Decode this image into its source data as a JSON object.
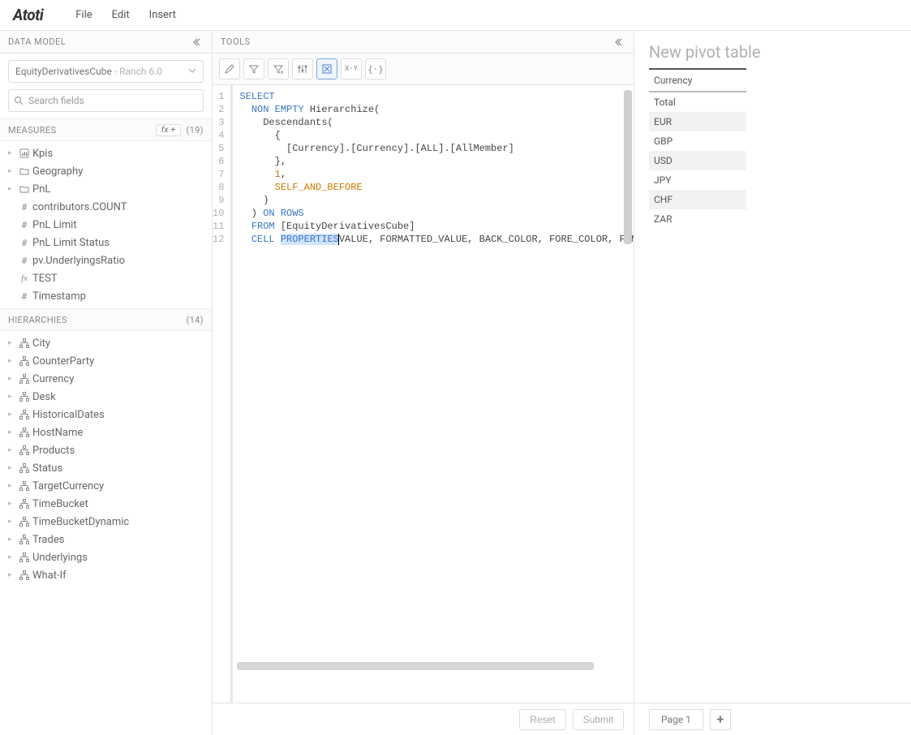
{
  "topbar": {
    "logo": "Atoti",
    "menu": [
      "File",
      "Edit",
      "Insert"
    ]
  },
  "left": {
    "header": "DATA MODEL",
    "cube_name": "EquityDerivativesCube",
    "cube_version": " - Ranch 6.0",
    "search_placeholder": "Search fields",
    "measures": {
      "title": "MEASURES",
      "fx_label": "fx +",
      "count": "(19)",
      "items": [
        {
          "icon": "kpi",
          "label": "Kpis",
          "caret": true
        },
        {
          "icon": "folder",
          "label": "Geography",
          "caret": true
        },
        {
          "icon": "folder",
          "label": "PnL",
          "caret": true
        },
        {
          "icon": "hash",
          "label": "contributors.COUNT",
          "caret": false
        },
        {
          "icon": "hash",
          "label": "PnL Limit",
          "caret": false
        },
        {
          "icon": "hash",
          "label": "PnL Limit Status",
          "caret": false
        },
        {
          "icon": "hash",
          "label": "pv.UnderlyingsRatio",
          "caret": false
        },
        {
          "icon": "fx",
          "label": "TEST",
          "caret": false
        },
        {
          "icon": "hash",
          "label": "Timestamp",
          "caret": false
        }
      ]
    },
    "hierarchies": {
      "title": "HIERARCHIES",
      "count": "(14)",
      "items": [
        "City",
        "CounterParty",
        "Currency",
        "Desk",
        "HistoricalDates",
        "HostName",
        "Products",
        "Status",
        "TargetCurrency",
        "TimeBucket",
        "TimeBucketDynamic",
        "Trades",
        "Underlyings",
        "What-If"
      ]
    }
  },
  "tools": {
    "header": "TOOLS",
    "buttons": [
      "edit",
      "filter",
      "funnel",
      "sliders",
      "mdx",
      "xy",
      "braces"
    ],
    "mdx_active_index": 4,
    "bottom": {
      "reset": "Reset",
      "submit": "Submit"
    }
  },
  "code": {
    "lines": [
      {
        "n": 1,
        "tokens": [
          {
            "t": "SELECT",
            "c": "kw"
          }
        ]
      },
      {
        "n": 2,
        "tokens": [
          {
            "t": "  "
          },
          {
            "t": "NON",
            "c": "kw"
          },
          {
            "t": " "
          },
          {
            "t": "EMPTY",
            "c": "kw"
          },
          {
            "t": " Hierarchize("
          }
        ]
      },
      {
        "n": 3,
        "tokens": [
          {
            "t": "    Descendants("
          }
        ]
      },
      {
        "n": 4,
        "tokens": [
          {
            "t": "      {"
          }
        ]
      },
      {
        "n": 5,
        "tokens": [
          {
            "t": "        [Currency].[Currency].[ALL].[AllMember]"
          }
        ]
      },
      {
        "n": 6,
        "tokens": [
          {
            "t": "      },"
          }
        ]
      },
      {
        "n": 7,
        "tokens": [
          {
            "t": "      "
          },
          {
            "t": "1",
            "c": "const"
          },
          {
            "t": ","
          }
        ]
      },
      {
        "n": 8,
        "tokens": [
          {
            "t": "      "
          },
          {
            "t": "SELF_AND_BEFORE",
            "c": "const"
          }
        ]
      },
      {
        "n": 9,
        "tokens": [
          {
            "t": "    )"
          }
        ]
      },
      {
        "n": 10,
        "tokens": [
          {
            "t": "  ) "
          },
          {
            "t": "ON",
            "c": "kw"
          },
          {
            "t": " "
          },
          {
            "t": "ROWS",
            "c": "kw"
          }
        ]
      },
      {
        "n": 11,
        "tokens": [
          {
            "t": "  "
          },
          {
            "t": "FROM",
            "c": "kw"
          },
          {
            "t": " [EquityDerivativesCube]"
          }
        ]
      },
      {
        "n": 12,
        "tokens": [
          {
            "t": "  "
          },
          {
            "t": "CELL",
            "c": "kw"
          },
          {
            "t": " "
          },
          {
            "t": "PROPERTIES",
            "c": "kw sel"
          },
          {
            "t": "|",
            "c": "cursor"
          },
          {
            "t": "VALUE, FORMATTED_VALUE, BACK_COLOR, FORE_COLOR, FONT_F"
          }
        ]
      }
    ]
  },
  "right": {
    "title": "New pivot table",
    "header": "Currency",
    "rows": [
      "Total",
      "EUR",
      "GBP",
      "USD",
      "JPY",
      "CHF",
      "ZAR"
    ],
    "page_label": "Page 1"
  }
}
